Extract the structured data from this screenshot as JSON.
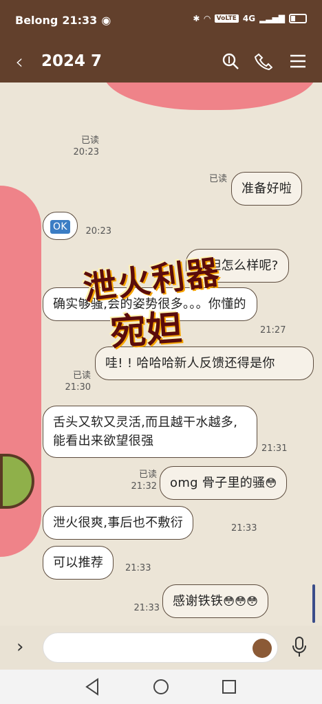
{
  "status_bar": {
    "carrier": "Belong",
    "time": "21:33",
    "volte": "VoLTE",
    "net": "4G"
  },
  "header": {
    "title": "2024 7"
  },
  "overlay": {
    "line1": "泄火利器",
    "line2": "宛妲"
  },
  "messages": [
    {
      "text": "准备好啦",
      "mine": true,
      "read": "已读",
      "time": ""
    },
    {
      "text": "OK",
      "mine": false,
      "time": "20:23"
    },
    {
      "text": "宛妲怎么样呢?",
      "mine": true,
      "read": "",
      "time": ""
    },
    {
      "text": "确实够骚,会的姿势很多。。。你懂的",
      "mine": false,
      "time": "21:27"
    },
    {
      "text": "哇! ! 哈哈哈新人反馈还得是你",
      "mine": true,
      "read": "已读",
      "time": "21:30"
    },
    {
      "text": "舌头又软又灵活,而且越干水越多,能看出来欲望很强",
      "mine": false,
      "time": "21:31"
    },
    {
      "text": "omg 骨子里的骚",
      "mine": true,
      "read": "已读",
      "time": "21:32"
    },
    {
      "text": "泄火很爽,事后也不敷衍",
      "mine": false,
      "time": "21:33"
    },
    {
      "text": "可以推荐",
      "mine": false,
      "time": "21:33"
    },
    {
      "text": "感谢铁铁",
      "mine": true,
      "read": "",
      "time": "21:33"
    }
  ],
  "photo_meta": {
    "read": "已读",
    "time": "20:23"
  },
  "icons": {
    "search": "search-icon",
    "phone": "phone-icon",
    "menu": "menu-icon",
    "mic": "mic-icon"
  }
}
